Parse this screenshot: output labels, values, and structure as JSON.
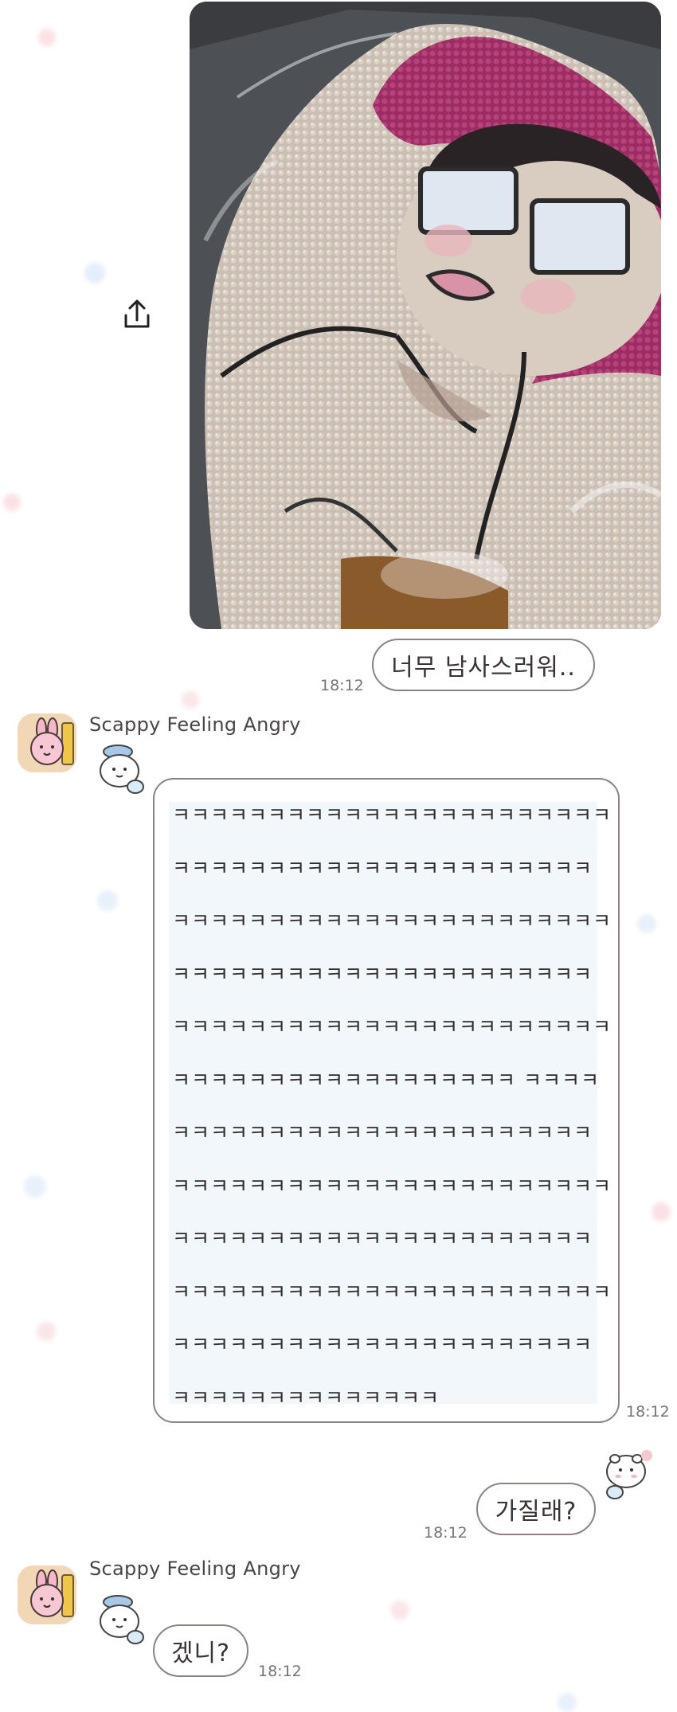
{
  "messages": {
    "photo": {
      "alt": "sequin pillow photo",
      "share_icon": "share-icon"
    },
    "sent_1": {
      "text": "너무 남사스러워..",
      "time": "18:12"
    },
    "received_1": {
      "sender": "Scappy Feeling Angry",
      "lines": [
        "ㅋㅋㅋㅋㅋㅋㅋㅋㅋㅋㅋㅋㅋㅋㅋㅋㅋㅋㅋㅋㅋㅋㅋ",
        "ㅋㅋㅋㅋㅋㅋㅋㅋㅋㅋㅋㅋㅋㅋㅋㅋㅋㅋㅋㅋㅋㅋ",
        "ㅋㅋㅋㅋㅋㅋㅋㅋㅋㅋㅋㅋㅋㅋㅋㅋㅋㅋㅋㅋㅋㅋㅋ",
        "ㅋㅋㅋㅋㅋㅋㅋㅋㅋㅋㅋㅋㅋㅋㅋㅋㅋㅋㅋㅋㅋㅋ",
        "ㅋㅋㅋㅋㅋㅋㅋㅋㅋㅋㅋㅋㅋㅋㅋㅋㅋㅋㅋㅋㅋㅋㅋ",
        "ㅋㅋㅋㅋㅋㅋㅋㅋㅋㅋㅋㅋㅋㅋㅋㅋㅋㅋ ㅋㅋㅋㅋ",
        "ㅋㅋㅋㅋㅋㅋㅋㅋㅋㅋㅋㅋㅋㅋㅋㅋㅋㅋㅋㅋㅋㅋ",
        "ㅋㅋㅋㅋㅋㅋㅋㅋㅋㅋㅋㅋㅋㅋㅋㅋㅋㅋㅋㅋㅋㅋㅋ",
        "ㅋㅋㅋㅋㅋㅋㅋㅋㅋㅋㅋㅋㅋㅋㅋㅋㅋㅋㅋㅋㅋㅋ",
        "ㅋㅋㅋㅋㅋㅋㅋㅋㅋㅋㅋㅋㅋㅋㅋㅋㅋㅋㅋㅋㅋㅋㅋ",
        "ㅋㅋㅋㅋㅋㅋㅋㅋㅋㅋㅋㅋㅋㅋㅋㅋㅋㅋㅋㅋㅋㅋ",
        "ㅋㅋㅋㅋㅋㅋㅋㅋㅋㅋㅋㅋㅋㅋ"
      ],
      "time": "18:12"
    },
    "sent_2": {
      "text": "가질래?",
      "time": "18:12"
    },
    "received_2": {
      "sender": "Scappy Feeling Angry",
      "text": "겠니?",
      "time": "18:12"
    }
  },
  "colors": {
    "bubble_border": "#8d8282",
    "bubble_fill": "#ffffff",
    "message_highlight": "#f2f7fc",
    "avatar_bg": "#f3dcc0"
  }
}
